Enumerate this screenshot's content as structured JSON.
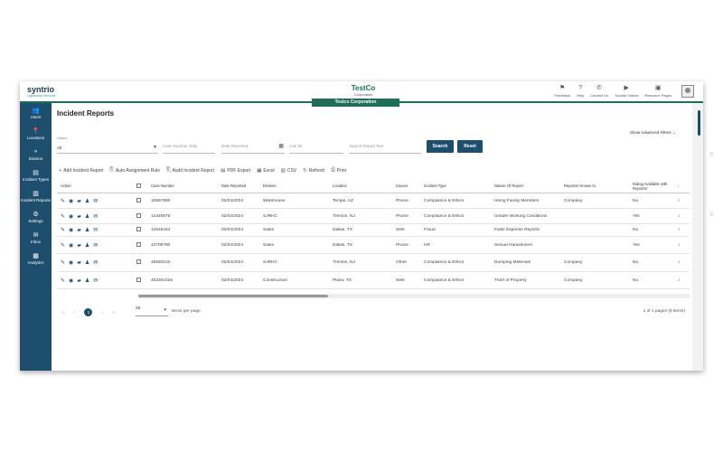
{
  "header": {
    "logo": "syntrio",
    "logo_sub": "Lighthouse Services",
    "brand": "TestCo",
    "brand_sub": "Corporation",
    "corp_tab": "Testco Corporation",
    "utils": [
      {
        "icon": "flag-icon",
        "glyph": "⚑",
        "label": "Feedback"
      },
      {
        "icon": "help-icon",
        "glyph": "?",
        "label": "Help"
      },
      {
        "icon": "phone-icon",
        "glyph": "✆",
        "label": "Contact Us"
      },
      {
        "icon": "video-icon",
        "glyph": "▶",
        "label": "Tutorial Videos"
      },
      {
        "icon": "resource-icon",
        "glyph": "▣",
        "label": "Resource Pages"
      }
    ]
  },
  "sidebar": {
    "items": [
      {
        "icon": "users-icon",
        "glyph": "👥",
        "label": "Users"
      },
      {
        "icon": "location-icon",
        "glyph": "📍",
        "label": "Locations"
      },
      {
        "icon": "division-icon",
        "glyph": "⚬",
        "label": "Division"
      },
      {
        "icon": "incident-types-icon",
        "glyph": "▤",
        "label": "Incident Types"
      },
      {
        "icon": "incident-reports-icon",
        "glyph": "▥",
        "label": "Incident Reports"
      },
      {
        "icon": "settings-icon",
        "glyph": "⚙",
        "label": "Settings"
      },
      {
        "icon": "inbox-icon",
        "glyph": "✉",
        "label": "Inbox"
      },
      {
        "icon": "analytics-icon",
        "glyph": "▦",
        "label": "Analytics"
      }
    ]
  },
  "page": {
    "title": "Incident Reports",
    "advanced_filters": "Show Advanced Filters",
    "status_label": "Status",
    "status_value": "All",
    "case_placeholder": "Case Number Only",
    "date_placeholder": "Date Reported",
    "link_placeholder": "Link ID",
    "text_placeholder": "Search Report Text",
    "search_button": "Search",
    "reset_button": "Reset"
  },
  "toolbar": [
    {
      "icon": "add-icon",
      "glyph": "+",
      "label": "Add Incident Report"
    },
    {
      "icon": "auto-assign-icon",
      "glyph": "⎘",
      "label": "Auto Assignment Rule"
    },
    {
      "icon": "audit-icon",
      "glyph": "⎘",
      "label": "Audit Incident Report"
    },
    {
      "icon": "pdf-icon",
      "glyph": "▤",
      "label": "PDF Export"
    },
    {
      "icon": "excel-icon",
      "glyph": "▦",
      "label": "Excel"
    },
    {
      "icon": "csv-icon",
      "glyph": "▥",
      "label": "CSV"
    },
    {
      "icon": "refresh-icon",
      "glyph": "↻",
      "label": "Refresh"
    },
    {
      "icon": "print-icon",
      "glyph": "⎙",
      "label": "Print"
    }
  ],
  "table": {
    "headers": [
      "Action",
      "Case Number",
      "Date Reported",
      "Division",
      "Location",
      "Source",
      "Incident Type",
      "Nature Of Report",
      "Reporter Known to",
      "Dialog Available with Reporter"
    ],
    "rows": [
      {
        "case": "10567890",
        "date": "02/04/2024",
        "division": "Warehouse",
        "location": "Tempe, AZ",
        "source": "Phone",
        "type": "Compliance & Ethics",
        "nature": "Hiring Family Members",
        "reporter": "Company",
        "dialog": "No"
      },
      {
        "case": "12345678",
        "date": "02/04/2024",
        "division": "SJRHC",
        "location": "Trenton, NJ",
        "source": "Phone",
        "type": "Compliance & Ethics",
        "nature": "Unsafe Working Conditions",
        "reporter": "",
        "dialog": "Yes"
      },
      {
        "case": "12645444",
        "date": "02/04/2024",
        "division": "Sales",
        "location": "Dallas, TX",
        "source": "Web",
        "type": "Fraud",
        "nature": "False Expense Reports",
        "reporter": "",
        "dialog": "No"
      },
      {
        "case": "42706780",
        "date": "02/04/2024",
        "division": "Sales",
        "location": "Dallas, TX",
        "source": "Phone",
        "type": "HR",
        "nature": "Sexual Harassment",
        "reporter": "",
        "dialog": "Yes"
      },
      {
        "case": "45560102",
        "date": "02/04/2024",
        "division": "SJRHC",
        "location": "Trenton, NJ",
        "source": "Other",
        "type": "Compliance & Ethics",
        "nature": "Dumping Materials",
        "reporter": "Company",
        "dialog": "No"
      },
      {
        "case": "463251025",
        "date": "02/04/2024",
        "division": "Construction",
        "location": "Plano, TX",
        "source": "Web",
        "type": "Compliance & Ethics",
        "nature": "Theft of Property",
        "reporter": "Company",
        "dialog": "No"
      }
    ]
  },
  "pagination": {
    "current_page": "1",
    "per_page": "25",
    "per_page_label": "items per page",
    "info": "1 of 1 pages (6 items)"
  },
  "colors": {
    "sidebar": "#1e4e6e",
    "accent": "#1e6e5a",
    "button": "#1e4e6e"
  }
}
